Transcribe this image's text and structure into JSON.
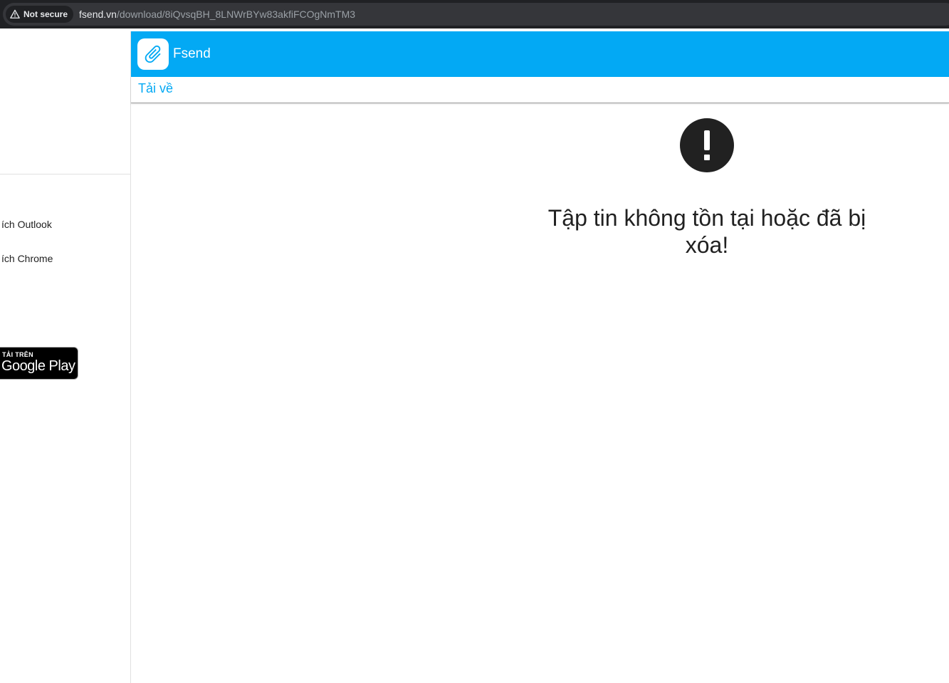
{
  "browser": {
    "security_label": "Not secure",
    "url_host": "fsend.vn",
    "url_path": "/download/8iQvsqBH_8LNWrBYw83akfiFCOgNmTM3"
  },
  "sidebar": {
    "items": [
      {
        "label": "ích Outlook"
      },
      {
        "label": "ích Chrome"
      }
    ],
    "store_badge": {
      "small_text": "TẢI TRÊN",
      "big_text": "Google Play"
    }
  },
  "header": {
    "app_name": "Fsend",
    "brand_color": "#03a9f4"
  },
  "tabs": {
    "download_label": "Tải về"
  },
  "main": {
    "error_icon": "exclamation-circle-icon",
    "message": "Tập tin không tồn tại hoặc đã bị xóa!"
  }
}
